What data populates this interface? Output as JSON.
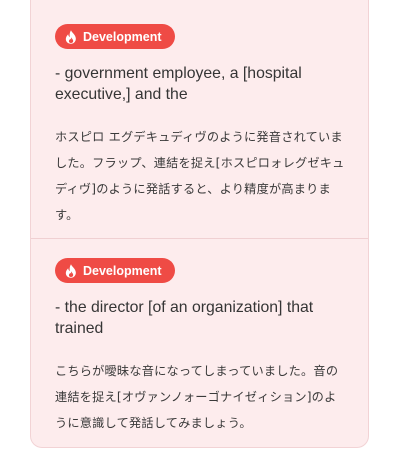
{
  "colors": {
    "card_background": "#fdeced",
    "badge_background": "#ef4b45",
    "badge_text": "#ffffff",
    "text": "#353535"
  },
  "items": [
    {
      "badge": {
        "icon": "flame-icon",
        "label": "Development"
      },
      "phrase": "- government employee, a [hospital executive,] and the",
      "explanation": "ホスピロ エグデキュディヴのように発音されていました。フラップ、連結を捉え[ホスピロォレグゼキュディヴ]のように発話すると、より精度が高まります。"
    },
    {
      "badge": {
        "icon": "flame-icon",
        "label": "Development"
      },
      "phrase": "- the director [of an organization] that trained",
      "explanation": "こちらが曖昧な音になってしまっていました。音の連結を捉え[オヴァンノォーゴナイゼィション]のように意識して発話してみましょう。"
    }
  ]
}
